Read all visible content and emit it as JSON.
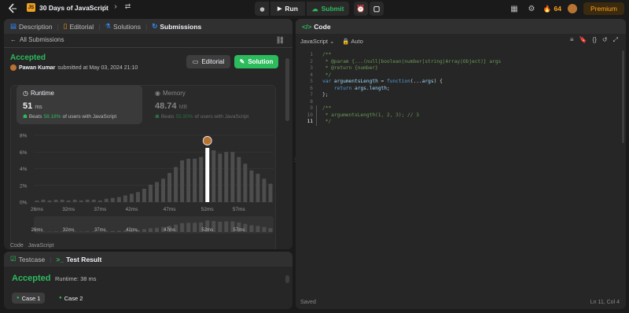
{
  "topbar": {
    "problem_list_title": "30 Days of JavaScript",
    "js_badge": "JS",
    "run_label": "Run",
    "submit_label": "Submit",
    "streak_count": "64",
    "premium_label": "Premium"
  },
  "left_tabs": {
    "description": "Description",
    "editorial": "Editorial",
    "solutions": "Solutions",
    "submissions": "Submissions"
  },
  "submission": {
    "back_label": "All Submissions",
    "status": "Accepted",
    "author": "Pawan Kumar",
    "submitted_text": "submitted at May 03, 2024 21:10",
    "editorial_btn": "Editorial",
    "solution_btn": "Solution",
    "runtime_label": "Runtime",
    "runtime_value": "51",
    "runtime_unit": "ms",
    "runtime_beats_prefix": "Beats",
    "runtime_beats_pct": "58.18%",
    "runtime_beats_suffix": "of users with JavaScript",
    "memory_label": "Memory",
    "memory_value": "48.74",
    "memory_unit": "MB",
    "memory_beats_prefix": "Beats",
    "memory_beats_pct": "55.90%",
    "memory_beats_suffix": "of users with JavaScript",
    "code_lbl": "Code",
    "lang_lbl": "JavaScript"
  },
  "chart_data": {
    "type": "bar",
    "ytick_labels": [
      "8%",
      "6%",
      "4%",
      "2%",
      "0%"
    ],
    "yticks": [
      8,
      6,
      4,
      2,
      0
    ],
    "ylim": [
      0,
      8
    ],
    "xtick_labels": [
      "26ms",
      "32ms",
      "37ms",
      "42ms",
      "47ms",
      "52ms",
      "57ms"
    ],
    "values": [
      0.2,
      0.3,
      0.2,
      0.3,
      0.3,
      0.2,
      0.3,
      0.2,
      0.3,
      0.3,
      0.2,
      0.4,
      0.5,
      0.6,
      0.8,
      1.0,
      1.2,
      1.6,
      2.1,
      2.4,
      2.8,
      3.5,
      4.2,
      5.0,
      5.2,
      5.2,
      5.4,
      6.5,
      6.2,
      5.8,
      6.0,
      6.0,
      5.4,
      4.6,
      3.8,
      3.4,
      2.8,
      2.2
    ],
    "highlight_index": 27,
    "xlabels": {
      "26ms": 0,
      "32ms": 5,
      "37ms": 10,
      "42ms": 15,
      "47ms": 21,
      "52ms": 27,
      "57ms": 32
    }
  },
  "bottom_left": {
    "testcase_tab": "Testcase",
    "testresult_tab": "Test Result",
    "status": "Accepted",
    "runtime_text": "Runtime: 38 ms",
    "case1": "Case 1",
    "case2": "Case 2"
  },
  "code_panel": {
    "title": "Code",
    "language": "JavaScript",
    "mode": "Auto",
    "status_saved": "Saved",
    "cursor_pos": "Ln 11, Col 4",
    "lines": [
      {
        "n": "1",
        "text": "/**"
      },
      {
        "n": "2",
        "text": " * @param {...(null|boolean|number|string|Array|Object)} args"
      },
      {
        "n": "3",
        "text": " * @return {number}"
      },
      {
        "n": "4",
        "text": " */"
      },
      {
        "n": "5",
        "text": "var argumentsLength = function(...args) {"
      },
      {
        "n": "6",
        "text": "    return args.length;"
      },
      {
        "n": "7",
        "text": "};"
      },
      {
        "n": "8",
        "text": ""
      },
      {
        "n": "9",
        "text": "/**"
      },
      {
        "n": "10",
        "text": " * argumentsLength(1, 2, 3); // 3"
      },
      {
        "n": "11",
        "text": " */"
      }
    ]
  },
  "colors": {
    "accent_green": "#2cbb5d",
    "accent_orange": "#ffa116",
    "bar_grey": "#4d4d4d",
    "bar_highlight": "#ffffff"
  }
}
